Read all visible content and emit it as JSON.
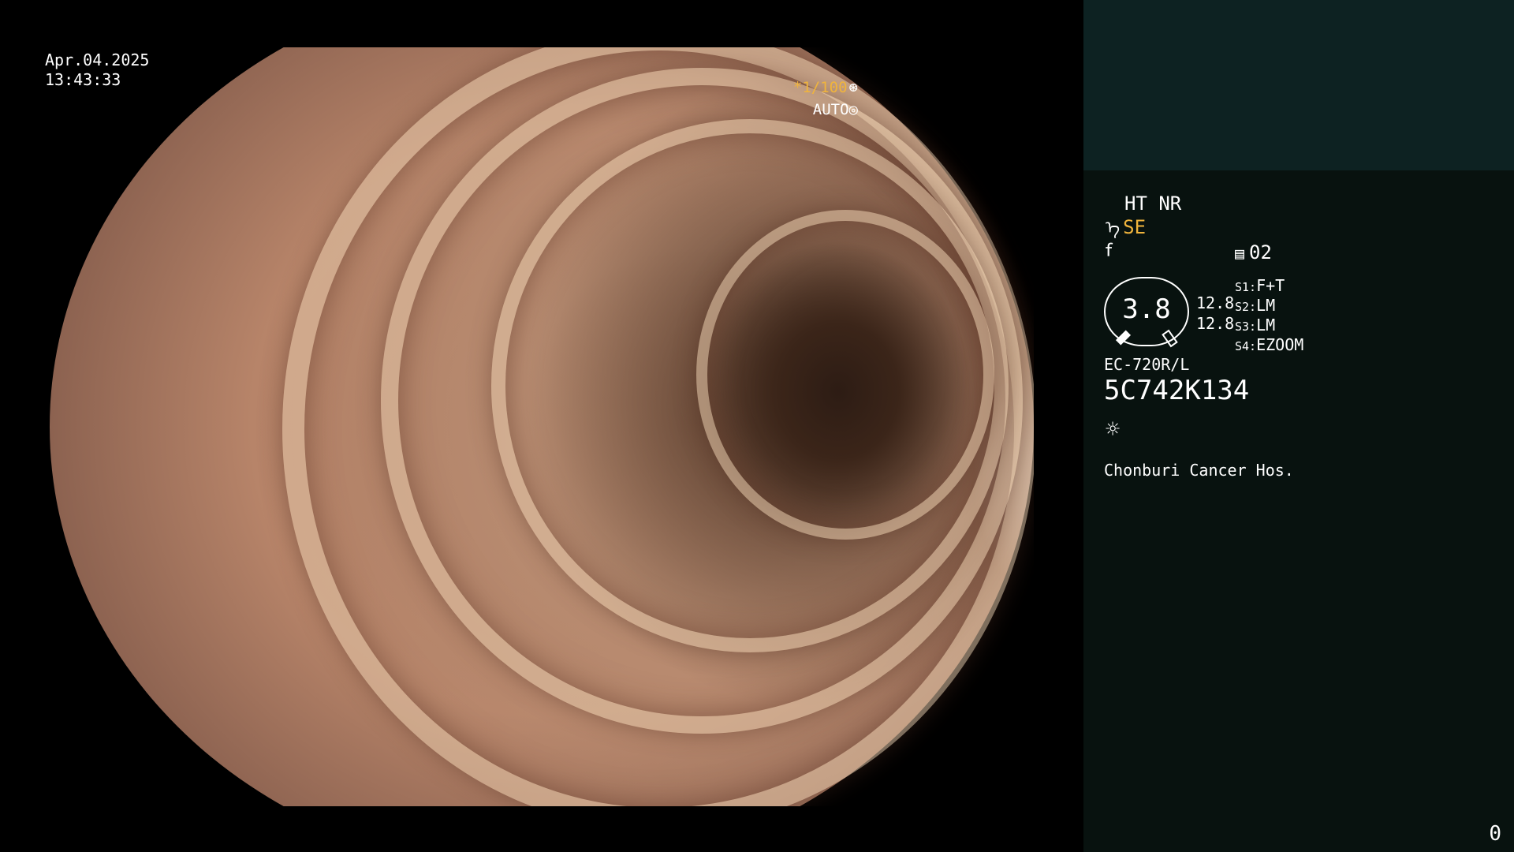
{
  "overlay": {
    "date": "Apr.04.2025",
    "time": "13:43:33",
    "shutter": "*1/100",
    "shutter_icon": "⊛",
    "exposure": "AUTO",
    "exposure_icon": "◎"
  },
  "panel": {
    "mode": "HT NR",
    "se_icon": "ᠡ",
    "se_label": "SE",
    "f_icon": "ꬵ",
    "memory_icon": "▤",
    "memory_value": "02",
    "zoom_value": "3.8",
    "zoom_num_1": "12.8",
    "zoom_num_2": "12.8",
    "switches": [
      {
        "key": "S1:",
        "value": "F+T"
      },
      {
        "key": "S2:",
        "value": "LM"
      },
      {
        "key": "S3:",
        "value": "LM"
      },
      {
        "key": "S4:",
        "value": "EZOOM"
      }
    ],
    "scope_model": "EC-720R/L",
    "serial": "5C742K134",
    "light_icon": "☼",
    "hospital": "Chonburi Cancer Hos.",
    "counter": "0"
  },
  "colors": {
    "accent_orange": "#f0b43c",
    "panel_top": "#0d2222",
    "panel_bg": "#08120f"
  }
}
